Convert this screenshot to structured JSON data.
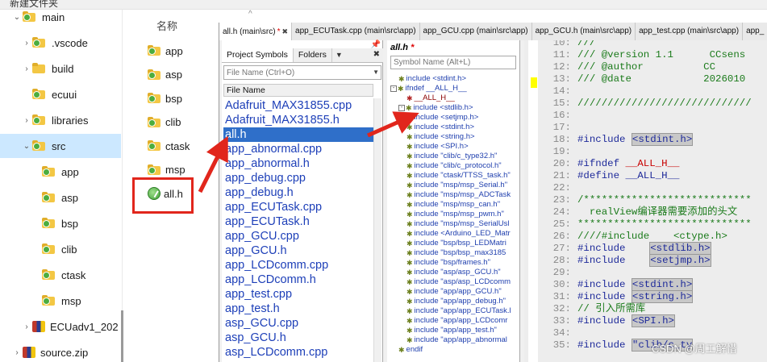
{
  "topbar": {
    "title": "新建文件夹"
  },
  "explorer": {
    "tree": [
      {
        "label": "main",
        "chevron": "⌄",
        "indent": 14,
        "icon": "git-folder",
        "selected": false
      },
      {
        "label": ".vscode",
        "chevron": "›",
        "indent": 26,
        "icon": "git-folder",
        "selected": false
      },
      {
        "label": "build",
        "chevron": "›",
        "indent": 26,
        "icon": "folder",
        "selected": false
      },
      {
        "label": "ecuui",
        "chevron": "",
        "indent": 26,
        "icon": "git-folder",
        "selected": false
      },
      {
        "label": "libraries",
        "chevron": "›",
        "indent": 26,
        "icon": "git-folder",
        "selected": false
      },
      {
        "label": "src",
        "chevron": "⌄",
        "indent": 26,
        "icon": "git-folder",
        "selected": true
      },
      {
        "label": "app",
        "chevron": "",
        "indent": 38,
        "icon": "git-folder",
        "selected": false
      },
      {
        "label": "asp",
        "chevron": "",
        "indent": 38,
        "icon": "git-folder",
        "selected": false
      },
      {
        "label": "bsp",
        "chevron": "",
        "indent": 38,
        "icon": "git-folder",
        "selected": false
      },
      {
        "label": "clib",
        "chevron": "",
        "indent": 38,
        "icon": "git-folder",
        "selected": false
      },
      {
        "label": "ctask",
        "chevron": "",
        "indent": 38,
        "icon": "git-folder",
        "selected": false
      },
      {
        "label": "msp",
        "chevron": "",
        "indent": 38,
        "icon": "git-folder",
        "selected": false
      },
      {
        "label": "ECUadv1_202",
        "chevron": "›",
        "indent": 26,
        "icon": "app",
        "selected": false
      },
      {
        "label": "source.zip",
        "chevron": "›",
        "indent": 14,
        "icon": "app",
        "selected": false
      }
    ],
    "column_header": "名称",
    "files": [
      {
        "label": "app",
        "icon": "git-folder"
      },
      {
        "label": "asp",
        "icon": "git-folder"
      },
      {
        "label": "bsp",
        "icon": "git-folder"
      },
      {
        "label": "clib",
        "icon": "git-folder"
      },
      {
        "label": "ctask",
        "icon": "git-folder"
      },
      {
        "label": "msp",
        "icon": "git-folder"
      },
      {
        "label": "all.h",
        "icon": "h-file"
      }
    ]
  },
  "editor": {
    "tabs": [
      {
        "label": "all.h (main\\src)",
        "modified": "*",
        "close": "✖",
        "active": true
      },
      {
        "label": "app_ECUTask.cpp (main\\src\\app)",
        "modified": "",
        "close": "",
        "active": false
      },
      {
        "label": "app_GCU.cpp (main\\src\\app)",
        "modified": "",
        "close": "",
        "active": false
      },
      {
        "label": "app_GCU.h (main\\src\\app)",
        "modified": "",
        "close": "",
        "active": false
      },
      {
        "label": "app_test.cpp (main\\src\\app)",
        "modified": "",
        "close": "",
        "active": false
      },
      {
        "label": "app_",
        "modified": "",
        "close": "",
        "active": false
      }
    ],
    "left_panel": {
      "tabs": [
        "Project Symbols",
        "Folders"
      ],
      "pin": "📌",
      "close": "✖",
      "menu": "▼",
      "filter_placeholder": "File Name (Ctrl+O)",
      "list_header": "File Name",
      "files": [
        "Adafruit_MAX31855.cpp",
        "Adafruit_MAX31855.h",
        "all.h",
        "app_abnormal.cpp",
        "app_abnormal.h",
        "app_debug.cpp",
        "app_debug.h",
        "app_ECUTask.cpp",
        "app_ECUTask.h",
        "app_GCU.cpp",
        "app_GCU.h",
        "app_LCDcomm.cpp",
        "app_LCDcomm.h",
        "app_test.cpp",
        "app_test.h",
        "asp_GCU.cpp",
        "asp_GCU.h",
        "asp_LCDcomm.cpp"
      ],
      "selected_index": 2
    },
    "mid_panel": {
      "title": "all.h",
      "modified": "*",
      "search_placeholder": "Symbol Name (Alt+L)",
      "rows": [
        {
          "text": "include <stdint.h>",
          "indent": 10,
          "box": "",
          "kind": "inc"
        },
        {
          "text": "ifndef __ALL_H__",
          "indent": 0,
          "box": "-",
          "kind": "inc"
        },
        {
          "text": "__ALL_H__",
          "indent": 20,
          "box": "",
          "kind": "macro"
        },
        {
          "text": "include <stdlib.h>",
          "indent": 10,
          "box": "-",
          "kind": "inc"
        },
        {
          "text": "include <setjmp.h>",
          "indent": 20,
          "box": "",
          "kind": "inc"
        },
        {
          "text": "include <stdint.h>",
          "indent": 20,
          "box": "",
          "kind": "inc"
        },
        {
          "text": "include <string.h>",
          "indent": 20,
          "box": "",
          "kind": "inc"
        },
        {
          "text": "include <SPI.h>",
          "indent": 20,
          "box": "",
          "kind": "inc"
        },
        {
          "text": "include \"clib/c_type32.h\"",
          "indent": 20,
          "box": "",
          "kind": "inc"
        },
        {
          "text": "include \"clib/c_protocol.h\"",
          "indent": 20,
          "box": "",
          "kind": "inc"
        },
        {
          "text": "include \"ctask/TTSS_task.h\"",
          "indent": 20,
          "box": "",
          "kind": "inc"
        },
        {
          "text": "include \"msp/msp_Serial.h\"",
          "indent": 20,
          "box": "",
          "kind": "inc"
        },
        {
          "text": "include \"msp/msp_ADCTask",
          "indent": 20,
          "box": "",
          "kind": "inc"
        },
        {
          "text": "include \"msp/msp_can.h\"",
          "indent": 20,
          "box": "",
          "kind": "inc"
        },
        {
          "text": "include \"msp/msp_pwm.h\"",
          "indent": 20,
          "box": "",
          "kind": "inc"
        },
        {
          "text": "include \"msp/msp_SerialUsl",
          "indent": 20,
          "box": "",
          "kind": "inc"
        },
        {
          "text": "include <Arduino_LED_Matr",
          "indent": 20,
          "box": "",
          "kind": "inc"
        },
        {
          "text": "include \"bsp/bsp_LEDMatri",
          "indent": 20,
          "box": "",
          "kind": "inc"
        },
        {
          "text": "include \"bsp/bsp_max3185",
          "indent": 20,
          "box": "",
          "kind": "inc"
        },
        {
          "text": "include \"bsp/frames.h\"",
          "indent": 20,
          "box": "",
          "kind": "inc"
        },
        {
          "text": "include \"asp/asp_GCU.h\"",
          "indent": 20,
          "box": "",
          "kind": "inc"
        },
        {
          "text": "include \"asp/asp_LCDcomm",
          "indent": 20,
          "box": "",
          "kind": "inc"
        },
        {
          "text": "include \"app/app_GCU.h\"",
          "indent": 20,
          "box": "",
          "kind": "inc"
        },
        {
          "text": "include \"app/app_debug.h\"",
          "indent": 20,
          "box": "",
          "kind": "inc"
        },
        {
          "text": "include \"app/app_ECUTask.l",
          "indent": 20,
          "box": "",
          "kind": "inc"
        },
        {
          "text": "include \"app/app_LCDcomr",
          "indent": 20,
          "box": "",
          "kind": "inc"
        },
        {
          "text": "include \"app/app_test.h\"",
          "indent": 20,
          "box": "",
          "kind": "inc"
        },
        {
          "text": "include \"app/app_abnormal",
          "indent": 20,
          "box": "",
          "kind": "inc"
        },
        {
          "text": "endif",
          "indent": 10,
          "box": "",
          "kind": "inc"
        }
      ]
    },
    "code": [
      {
        "num": "10:",
        "parts": [
          {
            "t": "///",
            "c": "cm"
          }
        ]
      },
      {
        "num": "11:",
        "parts": [
          {
            "t": "/// @version 1.1      CCsens ",
            "c": "cm"
          }
        ]
      },
      {
        "num": "12:",
        "parts": [
          {
            "t": "/// @author          CC",
            "c": "cm"
          }
        ]
      },
      {
        "num": "13:",
        "parts": [
          {
            "t": "/// @date            2026010",
            "c": "cm"
          }
        ]
      },
      {
        "num": "14:",
        "parts": [
          {
            "t": "",
            "c": "cm"
          }
        ]
      },
      {
        "num": "15:",
        "parts": [
          {
            "t": "/////////////////////////////",
            "c": "cm"
          }
        ]
      },
      {
        "num": "16:",
        "parts": [
          {
            "t": "",
            "c": "cm"
          }
        ]
      },
      {
        "num": "17:",
        "parts": [
          {
            "t": "",
            "c": "cm"
          }
        ]
      },
      {
        "num": "18:",
        "parts": [
          {
            "t": "#include ",
            "c": "pp"
          },
          {
            "t": "<stdint.h>",
            "c": "hl"
          }
        ]
      },
      {
        "num": "19:",
        "parts": [
          {
            "t": "",
            "c": "cm"
          }
        ]
      },
      {
        "num": "20:",
        "parts": [
          {
            "t": "#ifndef ",
            "c": "pp"
          },
          {
            "t": "__ALL_H__",
            "c": "red"
          }
        ]
      },
      {
        "num": "21:",
        "parts": [
          {
            "t": "#define ",
            "c": "pp"
          },
          {
            "t": "__ALL_H__",
            "c": "pp"
          }
        ]
      },
      {
        "num": "22:",
        "parts": [
          {
            "t": "",
            "c": "cm"
          }
        ]
      },
      {
        "num": "23:",
        "parts": [
          {
            "t": "/****************************",
            "c": "cm"
          }
        ]
      },
      {
        "num": "24:",
        "parts": [
          {
            "t": "  realView编译器需要添加的头文",
            "c": "cm"
          }
        ]
      },
      {
        "num": "25:",
        "parts": [
          {
            "t": "*****************************",
            "c": "cm"
          }
        ]
      },
      {
        "num": "26:",
        "parts": [
          {
            "t": "////#include    <ctype.h>",
            "c": "cm"
          }
        ]
      },
      {
        "num": "27:",
        "parts": [
          {
            "t": "#include    ",
            "c": "pp"
          },
          {
            "t": "<stdlib.h>",
            "c": "hl"
          }
        ]
      },
      {
        "num": "28:",
        "parts": [
          {
            "t": "#include    ",
            "c": "pp"
          },
          {
            "t": "<setjmp.h>",
            "c": "hl"
          }
        ]
      },
      {
        "num": "29:",
        "parts": [
          {
            "t": "",
            "c": "cm"
          }
        ]
      },
      {
        "num": "30:",
        "parts": [
          {
            "t": "#include ",
            "c": "pp"
          },
          {
            "t": "<stdint.h>",
            "c": "hl"
          }
        ]
      },
      {
        "num": "31:",
        "parts": [
          {
            "t": "#include ",
            "c": "pp"
          },
          {
            "t": "<string.h>",
            "c": "hl"
          }
        ]
      },
      {
        "num": "32:",
        "parts": [
          {
            "t": "// 引入所需库",
            "c": "cm"
          }
        ]
      },
      {
        "num": "33:",
        "parts": [
          {
            "t": "#include ",
            "c": "pp"
          },
          {
            "t": "<SPI.h>",
            "c": "hl"
          }
        ]
      },
      {
        "num": "34:",
        "parts": [
          {
            "t": "",
            "c": "cm"
          }
        ]
      },
      {
        "num": "35:",
        "parts": [
          {
            "t": "#include ",
            "c": "pp"
          },
          {
            "t": "\"clib/c_ty",
            "c": "hl"
          }
        ]
      }
    ]
  },
  "watermark": "CSDN @周工解惜"
}
